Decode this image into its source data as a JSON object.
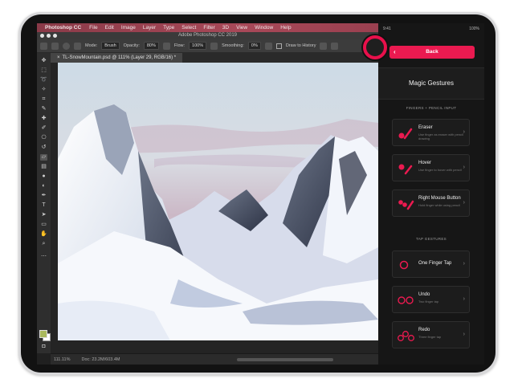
{
  "menubar": {
    "apple": "",
    "app": "Photoshop CC",
    "items": [
      "File",
      "Edit",
      "Image",
      "Layer",
      "Type",
      "Select",
      "Filter",
      "3D",
      "View",
      "Window",
      "Help"
    ]
  },
  "window": {
    "title": "Adobe Photoshop CC 2019"
  },
  "options": {
    "mode_label": "Mode:",
    "mode_value": "Brush",
    "opacity_label": "Opacity:",
    "opacity_value": "80%",
    "flow_label": "Flow:",
    "flow_value": "100%",
    "smoothing_label": "Smoothing:",
    "smoothing_value": "0%",
    "history_label": "Draw to History"
  },
  "document": {
    "tab": "TL-SnowMountain.psd @ 111% (Layer 29, RGB/16) *"
  },
  "status": {
    "zoom": "111.11%",
    "doc": "Doc: 23.2M/603.4M"
  },
  "panel": {
    "time": "9:41",
    "battery": "100%",
    "back_label": "Back",
    "title": "Magic Gestures",
    "section1": "FINGERS + PENCIL INPUT",
    "section2": "TAP GESTURES",
    "cards": [
      {
        "title": "Eraser",
        "sub": "Use finger as eraser with pencil drawing"
      },
      {
        "title": "Hover",
        "sub": "Use finger to hover with pencil"
      },
      {
        "title": "Right Mouse Button",
        "sub": "Hold finger while using pencil"
      },
      {
        "title": "One Finger Tap",
        "sub": ""
      },
      {
        "title": "Undo",
        "sub": "Two finger tap"
      },
      {
        "title": "Redo",
        "sub": "Three finger tap"
      }
    ]
  },
  "colors": {
    "accent": "#ea1a50",
    "foreground": "#a9b85c",
    "background": "#ffffff"
  }
}
